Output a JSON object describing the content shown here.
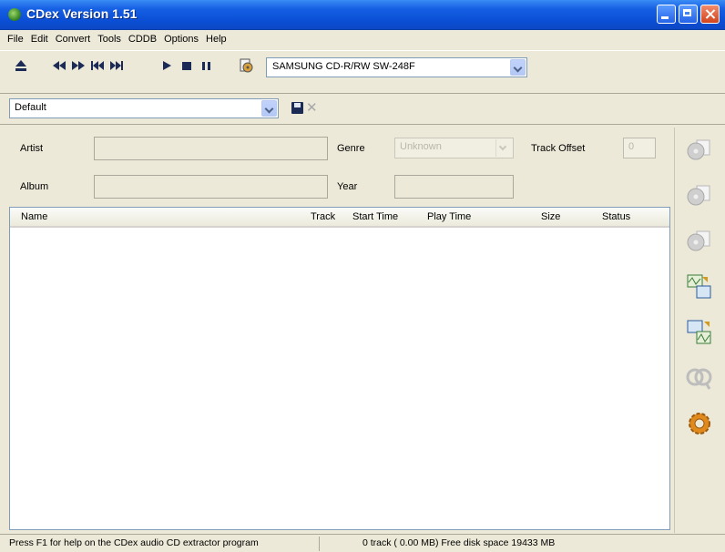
{
  "window": {
    "title": "CDex Version 1.51"
  },
  "menu": [
    "File",
    "Edit",
    "Convert",
    "Tools",
    "CDDB",
    "Options",
    "Help"
  ],
  "toolbar": {
    "icons": [
      "eject-icon",
      "rewind-icon",
      "fast-forward-icon",
      "previous-track-icon",
      "next-track-icon",
      "play-icon",
      "stop-icon",
      "pause-icon",
      "cd-info-icon"
    ],
    "drive": "SAMSUNG CD-R/RW SW-248F"
  },
  "profile": {
    "value": "Default"
  },
  "info": {
    "artist_label": "Artist",
    "artist_value": "",
    "album_label": "Album",
    "album_value": "",
    "genre_label": "Genre",
    "genre_value": "Unknown",
    "year_label": "Year",
    "year_value": "",
    "offset_label": "Track Offset",
    "offset_value": "0"
  },
  "tracklist": {
    "columns": [
      "Name",
      "Track",
      "Start Time",
      "Play Time",
      "Size",
      "Status"
    ],
    "rows": []
  },
  "status": {
    "help": "Press F1 for help on the CDex audio CD extractor program",
    "info": "0 track ( 0.00 MB) Free disk space 19433 MB"
  },
  "side_icons": [
    "extract-tracks-icon",
    "extract-mp3-icon",
    "extract-partial-icon",
    "convert-wav-mp3-icon",
    "convert-mp3-wav-icon",
    "cddb-lookup-icon",
    "configure-icon"
  ],
  "colors": {
    "titlebar": "#0a4fd6",
    "face": "#ece9d8",
    "border": "#7f9db9"
  }
}
